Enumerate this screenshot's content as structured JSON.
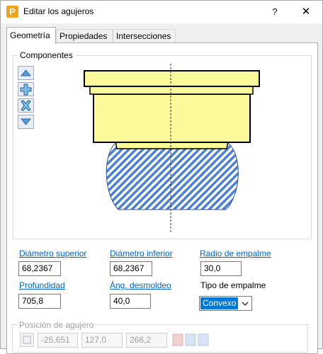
{
  "window": {
    "title": "Editar los agujeros",
    "app_letter": "P",
    "help_glyph": "?",
    "close_glyph": "✕"
  },
  "tabs": [
    {
      "label": "Geometría",
      "active": true
    },
    {
      "label": "Propiedades",
      "active": false
    },
    {
      "label": "Intersecciones",
      "active": false
    }
  ],
  "componentes": {
    "title": "Componentes",
    "buttons": [
      "move-up-icon",
      "add-icon",
      "remove-icon",
      "move-down-icon"
    ]
  },
  "fields": {
    "diametro_superior": {
      "label": "Diámetro superior",
      "value": "68,2367"
    },
    "diametro_inferior": {
      "label": "Diámetro inferior",
      "value": "68,2367"
    },
    "radio_empalme": {
      "label": "Radio de empalme",
      "value": "30,0"
    },
    "profundidad": {
      "label": "Profundidad",
      "value": "705,8"
    },
    "ang_desmoldeo": {
      "label": "Áng. desmoldeo",
      "value": "40,0"
    },
    "tipo_empalme": {
      "label": "Tipo de empalme",
      "value": "Convexo"
    }
  },
  "posicion": {
    "title": "Posición de agujero",
    "x": "-25,651",
    "y": "127,0",
    "z": "266,2"
  },
  "colors": {
    "link": "#0066cc",
    "shape_fill": "#fafa9b",
    "hatch": "#4a7fdc",
    "select_highlight": "#0078d7"
  }
}
